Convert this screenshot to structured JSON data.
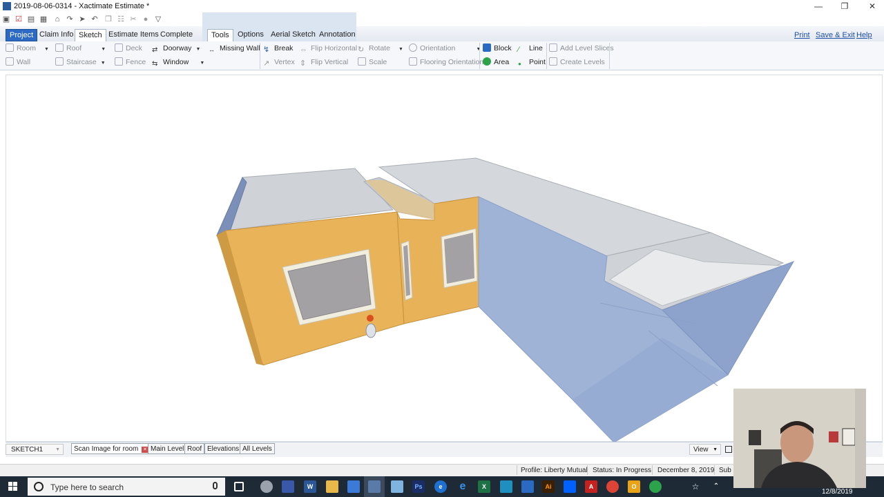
{
  "window": {
    "title": "2019-08-06-0314 - Xactimate Estimate *",
    "minimize": "—",
    "restore": "❐",
    "close": "✕"
  },
  "ribbon": {
    "tabs": [
      "Project",
      "Claim Info",
      "Sketch",
      "Estimate Items",
      "Complete"
    ],
    "tool_tabs": [
      "Tools",
      "Options",
      "Aerial Sketch",
      "Annotation"
    ],
    "links": {
      "print": "Print",
      "save_exit": "Save & Exit",
      "help": "Help"
    },
    "buttons": {
      "room": "Room",
      "wall": "Wall",
      "roof": "Roof",
      "staircase": "Staircase",
      "deck": "Deck",
      "fence": "Fence",
      "doorway": "Doorway",
      "window": "Window",
      "missing_wall": "Missing Wall",
      "break": "Break",
      "vertex": "Vertex",
      "flip_horizontal": "Flip Horizontal",
      "flip_vertical": "Flip Vertical",
      "rotate": "Rotate",
      "scale": "Scale",
      "orientation": "Orientation",
      "flooring_orientation": "Flooring Orientation",
      "block": "Block",
      "area": "Area",
      "line": "Line",
      "point": "Point",
      "add_level_slices": "Add Level Slices",
      "create_levels": "Create Levels"
    }
  },
  "bottom": {
    "sketch_selector": "SKETCH1",
    "tabs": [
      "Scan Image for room",
      "Main Level",
      "Roof",
      "Elevations",
      "All Levels"
    ],
    "view": "View"
  },
  "status": {
    "profile": "Profile: Liberty Mutual",
    "status": "Status: In Progress",
    "date": "December 8, 2019",
    "sub": "Sub"
  },
  "taskbar": {
    "search_placeholder": "Type here to search",
    "time": "12/8/2019"
  },
  "colors": {
    "accent": "#2c6ac3",
    "wall_front": "#e9b35a",
    "wall_side": "#9fb3d6",
    "taskbar": "#1e2a36"
  },
  "icons": [
    "windows-start-icon",
    "cortana-icon",
    "microphone-icon",
    "task-view-icon"
  ]
}
